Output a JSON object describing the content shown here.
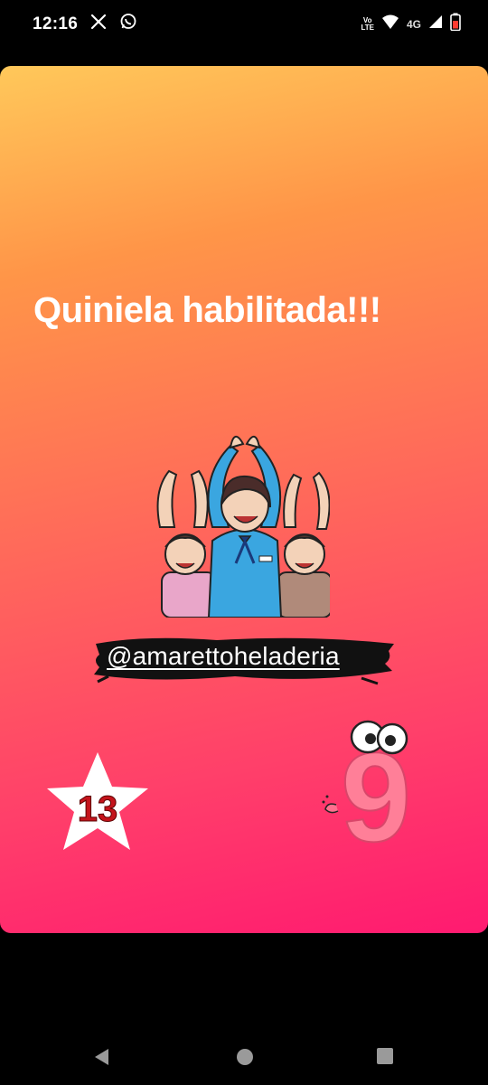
{
  "status_bar": {
    "time": "12:16",
    "network": "4G",
    "volte_top": "Vo",
    "volte_bottom": "LTE"
  },
  "story": {
    "headline": "Quiniela habilitada!!!",
    "handle": "@amarettoheladeria",
    "star_number": "13",
    "big_digit": "9"
  },
  "colors": {
    "gradient_top": "#ffc85a",
    "gradient_bottom": "#ff1a70",
    "brush_stroke": "#111111"
  },
  "icons": [
    "x-icon",
    "whatsapp-icon",
    "wifi-icon",
    "signal-icon",
    "battery-icon",
    "back-icon",
    "home-icon",
    "recents-icon"
  ]
}
